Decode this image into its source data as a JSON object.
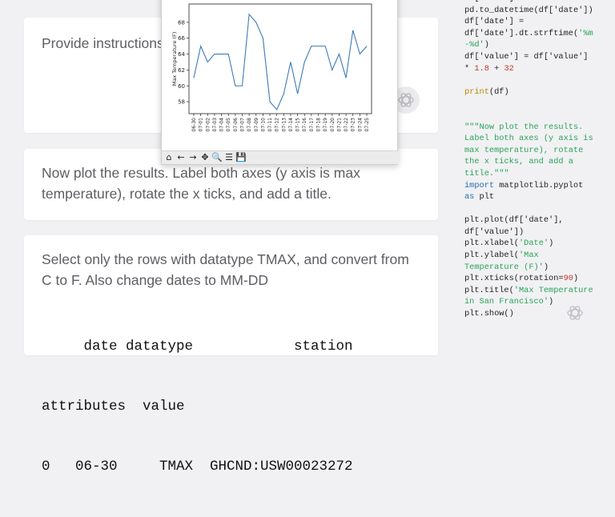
{
  "cards": [
    {
      "text": "Provide instructions"
    },
    {
      "text": "Now plot the results. Label both axes (y axis is max temperature), rotate the x ticks, and add a title."
    },
    {
      "text": "Select only the rows with datatype TMAX, and convert from C to F. Also change dates to MM-DD",
      "output_lines": [
        "     date datatype            station",
        "attributes  value",
        "0   06-30     TMAX  GHCND:USW00023272"
      ]
    }
  ],
  "plot_window": {
    "toolbar": [
      {
        "name": "home-icon",
        "glyph": "⌂"
      },
      {
        "name": "back-arrow-icon",
        "glyph": "←"
      },
      {
        "name": "forward-arrow-icon",
        "glyph": "→"
      },
      {
        "name": "pan-icon",
        "glyph": "✥"
      },
      {
        "name": "zoom-icon",
        "glyph": "🔍"
      },
      {
        "name": "configure-icon",
        "glyph": "☰"
      },
      {
        "name": "save-icon",
        "glyph": "💾"
      }
    ]
  },
  "chart_data": {
    "type": "line",
    "title": "",
    "xlabel": "",
    "ylabel": "Max Temperature (F)",
    "ylim": [
      56.5,
      70.3
    ],
    "yticks": [
      58,
      60,
      62,
      64,
      66,
      68
    ],
    "categories": [
      "06-30",
      "07-01",
      "07-02",
      "07-03",
      "07-04",
      "07-05",
      "07-06",
      "07-07",
      "07-08",
      "07-09",
      "07-10",
      "07-11",
      "07-12",
      "07-13",
      "07-14",
      "07-15",
      "07-16",
      "07-17",
      "07-18",
      "07-19",
      "07-20",
      "07-21",
      "07-22",
      "07-23",
      "07-24",
      "07-25"
    ],
    "values": [
      61,
      65,
      63,
      64,
      64,
      64,
      60,
      60,
      69,
      68,
      66,
      58,
      57,
      59,
      63,
      59,
      63,
      65,
      65,
      65,
      62,
      64,
      61,
      67,
      64,
      65
    ],
    "color": "#3d7ab7",
    "grid": false
  },
  "code_lines": [
    [
      [
        "df['date'] =",
        ""
      ]
    ],
    [
      [
        "pd.to_datetime(df['date'])",
        ""
      ]
    ],
    [
      [
        "df['date'] =",
        ""
      ]
    ],
    [
      [
        "df['date'].dt.strftime(",
        ""
      ],
      [
        "'%m",
        "str"
      ]
    ],
    [
      [
        "-%d'",
        "str"
      ],
      [
        ")",
        ""
      ]
    ],
    [
      [
        "df['value'] = df['value']",
        ""
      ]
    ],
    [
      [
        "* ",
        ""
      ],
      [
        "1.8",
        "num"
      ],
      [
        " + ",
        ""
      ],
      [
        "32",
        "num"
      ]
    ],
    [
      [
        "",
        ""
      ]
    ],
    [
      [
        "print",
        "fn"
      ],
      [
        "(df)",
        ""
      ]
    ],
    [
      [
        "",
        ""
      ]
    ],
    [
      [
        "",
        ""
      ]
    ],
    [
      [
        "\"\"\"Now plot the results.",
        "str"
      ]
    ],
    [
      [
        "Label both axes (y axis is",
        "str"
      ]
    ],
    [
      [
        "max temperature), rotate",
        "str"
      ]
    ],
    [
      [
        "the x ticks, and add a",
        "str"
      ]
    ],
    [
      [
        "title.\"\"\"",
        "str"
      ]
    ],
    [
      [
        "import",
        "kw"
      ],
      [
        " matplotlib.pyplot",
        ""
      ]
    ],
    [
      [
        "as",
        "kw"
      ],
      [
        " plt",
        ""
      ]
    ],
    [
      [
        "",
        ""
      ]
    ],
    [
      [
        "plt.plot(df['date'],",
        ""
      ]
    ],
    [
      [
        "df['value'])",
        ""
      ]
    ],
    [
      [
        "plt.xlabel(",
        ""
      ],
      [
        "'Date'",
        "str"
      ],
      [
        ")",
        ""
      ]
    ],
    [
      [
        "plt.ylabel(",
        ""
      ],
      [
        "'Max",
        "str"
      ]
    ],
    [
      [
        "Temperature (F)'",
        "str"
      ],
      [
        ")",
        ""
      ]
    ],
    [
      [
        "plt.xticks(rotation=",
        ""
      ],
      [
        "90",
        "num"
      ],
      [
        ")",
        ""
      ]
    ],
    [
      [
        "plt.title(",
        ""
      ],
      [
        "'Max Temperature",
        "str"
      ]
    ],
    [
      [
        "in San Francisco'",
        "str"
      ],
      [
        ")",
        ""
      ]
    ],
    [
      [
        "plt.show()",
        ""
      ]
    ]
  ]
}
